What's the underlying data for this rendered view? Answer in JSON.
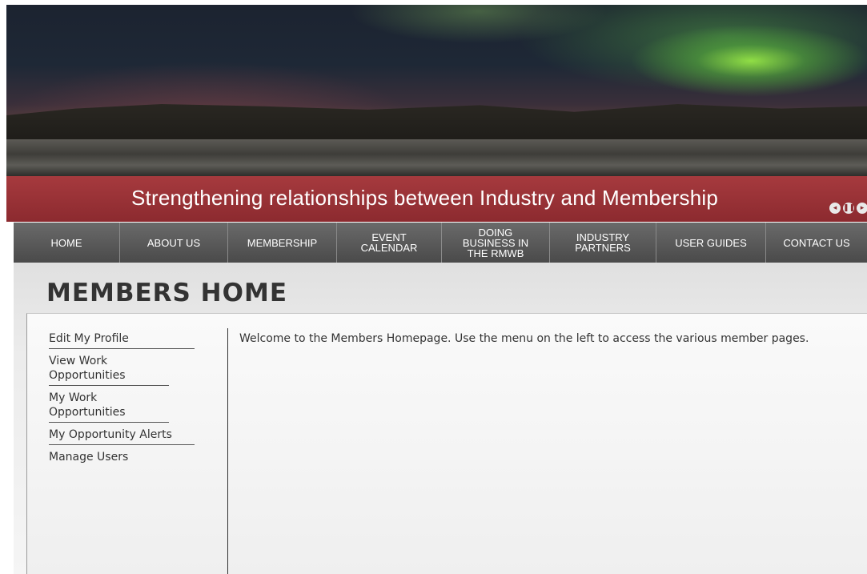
{
  "header": {
    "tagline": "Strengthening relationships between Industry and Membership",
    "slider_controls": [
      "◂",
      "❚❚",
      "▸"
    ]
  },
  "nav": {
    "items": [
      {
        "label": "HOME"
      },
      {
        "label": "ABOUT US"
      },
      {
        "label": "MEMBERSHIP"
      },
      {
        "label": "EVENT\nCALENDAR"
      },
      {
        "label": "DOING\nBUSINESS IN\nTHE RMWB"
      },
      {
        "label": "INDUSTRY\nPARTNERS"
      },
      {
        "label": "USER GUIDES"
      },
      {
        "label": "CONTACT US"
      }
    ]
  },
  "page": {
    "title": "MEMBERS HOME",
    "welcome": "Welcome to the Members Homepage.  Use the menu on the left to access the various member pages."
  },
  "sidebar": {
    "items": [
      {
        "label": "Edit My Profile"
      },
      {
        "label": "View Work Opportunities"
      },
      {
        "label": "My Work Opportunities"
      },
      {
        "label": "My Opportunity Alerts"
      },
      {
        "label": "Manage Users"
      }
    ]
  },
  "colors": {
    "tagline_bar": "#9c3337",
    "nav_bg": "#5a5a5a",
    "text": "#333333"
  }
}
